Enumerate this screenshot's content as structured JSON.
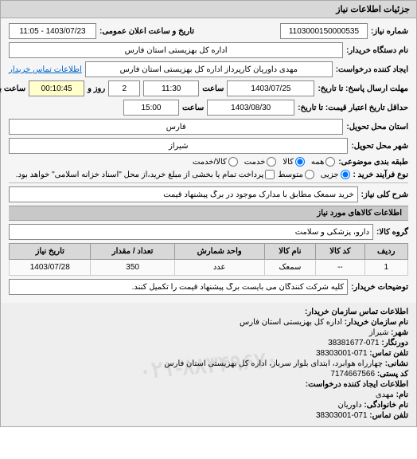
{
  "panel": {
    "title": "جزئیات اطلاعات نیاز"
  },
  "fields": {
    "need_number_label": "شماره نیاز:",
    "need_number": "1103000150000535",
    "announce_label": "تاریخ و ساعت اعلان عمومی:",
    "announce_value": "1403/07/23 - 11:05",
    "buyer_org_label": "نام دستگاه خریدار:",
    "buyer_org": "اداره کل بهزیستی استان فارس",
    "requester_label": "ایجاد کننده درخواست:",
    "requester": "مهدی داوریان کارپرداز اداره کل بهزیستی استان فارس",
    "buyer_contact_link": "اطلاعات تماس خریدار",
    "deadline_label": "مهلت ارسال پاسخ: تا تاریخ:",
    "deadline_date": "1403/07/25",
    "deadline_time_label": "ساعت",
    "deadline_time": "11:30",
    "deadline_days_label": "روز و",
    "deadline_days": "2",
    "deadline_remain_label": "ساعت باقی مانده",
    "deadline_remain": "00:10:45",
    "validity_label": "حداقل تاریخ اعتبار قیمت: تا تاریخ:",
    "validity_date": "1403/08/30",
    "validity_time_label": "ساعت",
    "validity_time": "15:00",
    "delivery_province_label": "استان محل تحویل:",
    "delivery_province": "فارس",
    "delivery_city_label": "شهر محل تحویل:",
    "delivery_city": "شیراز",
    "category_label": "طبقه بندی موضوعی:",
    "radio_all": "همه",
    "radio_goods": "کالا",
    "radio_service": "خدمت",
    "radio_goods_service": "کالا/خدمت",
    "buy_type_label": "نوع فرآیند خرید :",
    "radio_minor": "جزیی",
    "radio_medium": "متوسط",
    "buy_type_note": "پرداخت تمام یا بخشی از مبلغ خرید،از محل \"اسناد خزانه اسلامی\" خواهد بود.",
    "need_desc_label": "شرح کلی نیاز:",
    "need_desc": "خرید سمعک مطابق با مدارک موجود در برگ پیشنهاد قیمت",
    "items_section": "اطلاعات کالاهای مورد نیاز",
    "goods_group_label": "گروه کالا:",
    "goods_group": "دارو، پزشکی و سلامت",
    "buyer_note_label": "توضیحات خریدار:",
    "buyer_note": "کلیه شرکت کنندگان می بایست برگ پیشنهاد قیمت را تکمیل کنند."
  },
  "table": {
    "headers": {
      "row": "ردیف",
      "code": "کد کالا",
      "name": "نام کالا",
      "unit": "واحد شمارش",
      "qty": "تعداد / مقدار",
      "date": "تاریخ نیاز"
    },
    "rows": [
      {
        "row": "1",
        "code": "--",
        "name": "سمعک",
        "unit": "عدد",
        "qty": "350",
        "date": "1403/07/28"
      }
    ]
  },
  "contact": {
    "section": "اطلاعات تماس سازمان خریدار:",
    "org_label": "نام سازمان خریدار:",
    "org": "اداره کل بهزیستی استان فارس",
    "city_label": "شهر:",
    "city": "شیراز",
    "fax_label": "دورنگار:",
    "fax": "071-38381677",
    "phone_label": "تلفن تماس:",
    "phone": "071-38303001",
    "address_label": "نشانی:",
    "address": "چهارراه هوابرد، ابتدای بلوار سرباز، اداره کل بهزیستی استان فارس",
    "postal_label": "کد پستی:",
    "postal": "7174667566",
    "requester_section": "اطلاعات ایجاد کننده درخواست:",
    "name_label": "نام:",
    "name": "مهدی",
    "lastname_label": "نام خانوادگی:",
    "lastname": "داوریان",
    "req_phone_label": "تلفن تماس:",
    "req_phone": "071-38303001",
    "watermark": "۰۲۱-۸۸۳۴۹۶۷۰"
  }
}
